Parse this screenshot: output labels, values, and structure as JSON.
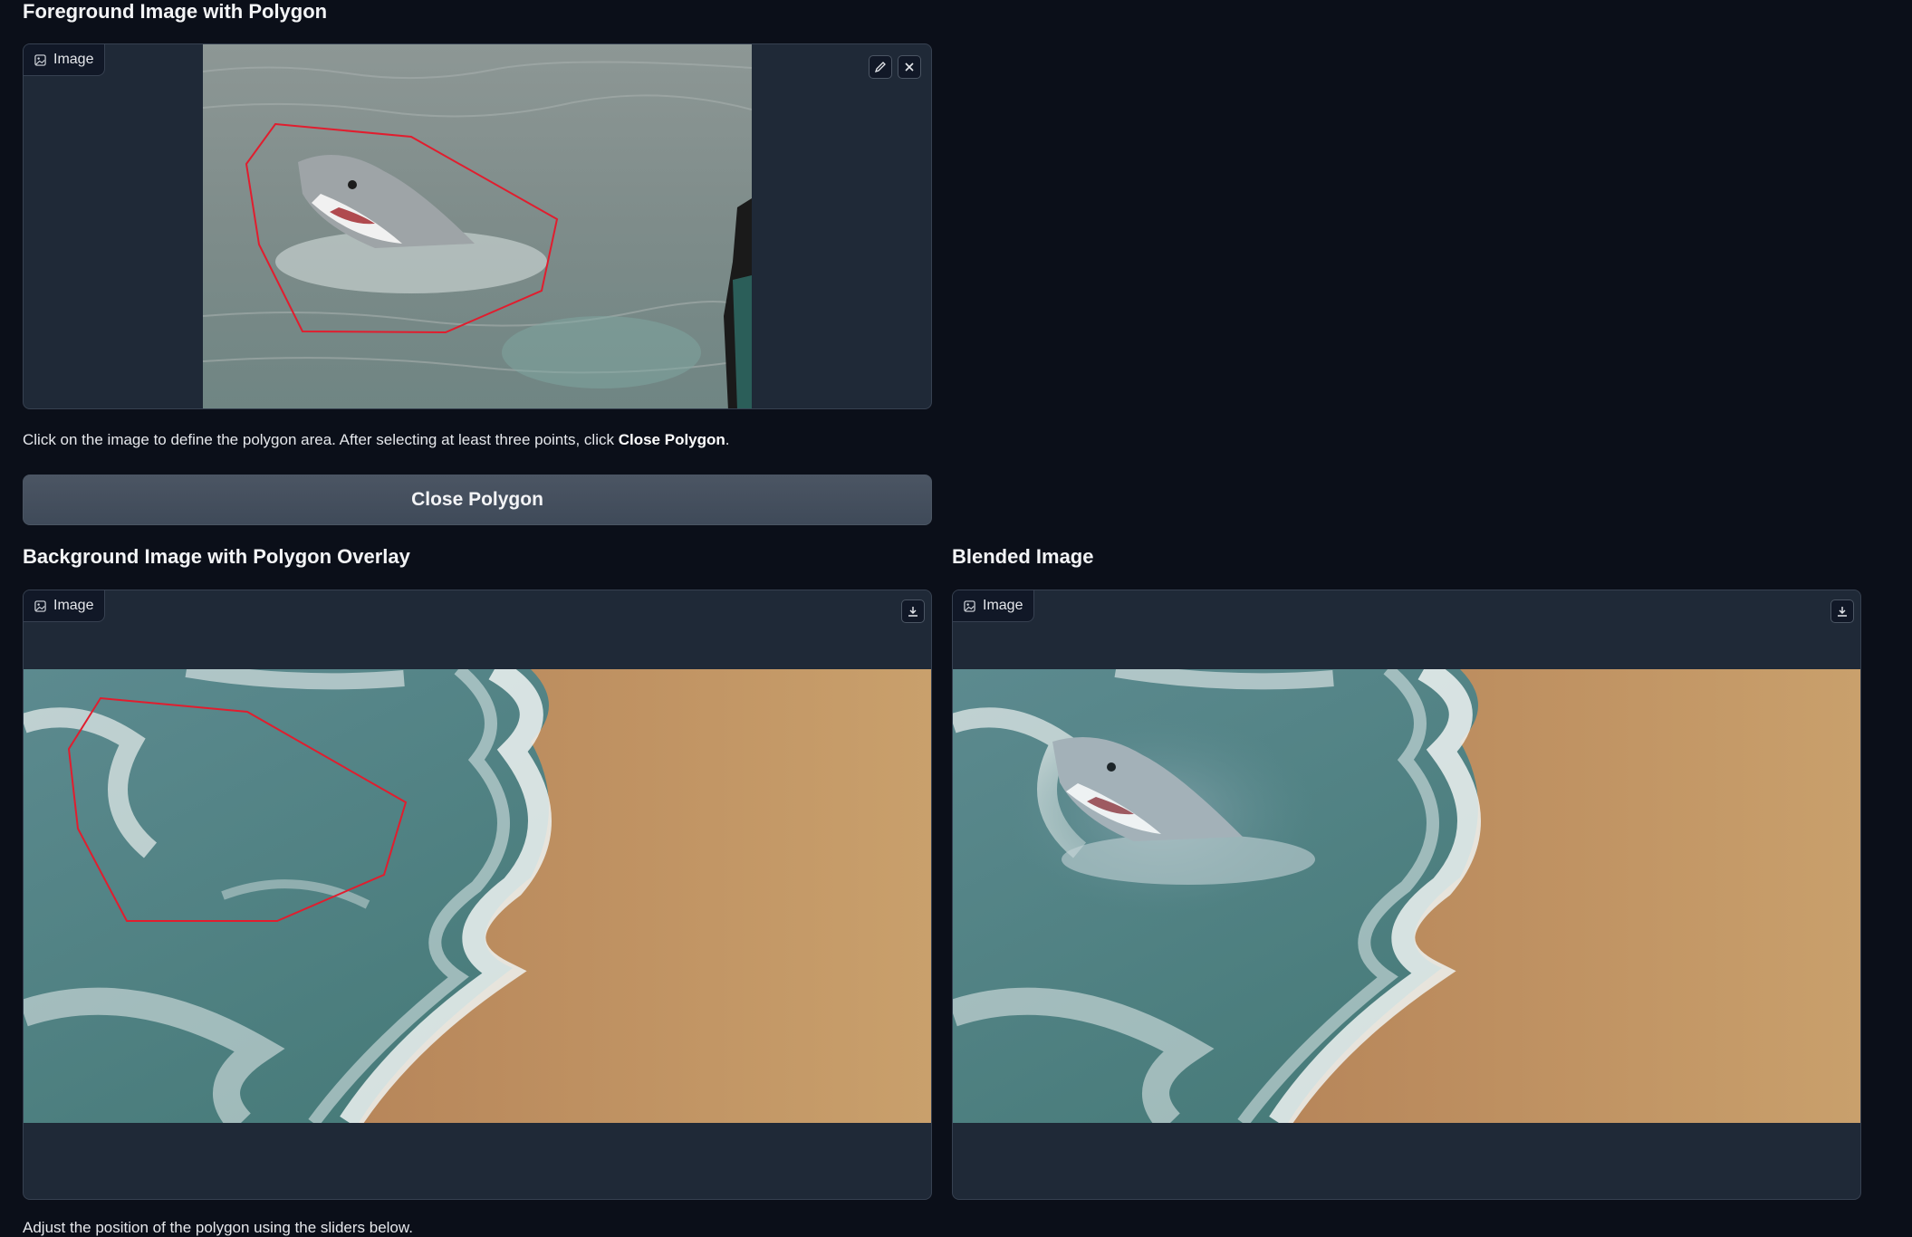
{
  "foreground": {
    "title": "Foreground Image with Polygon",
    "chip_label": "Image",
    "edit_icon": "pencil-icon",
    "close_icon": "close-icon"
  },
  "instructions": {
    "text_before": "Click on the image to define the polygon area. After selecting at least three points, click ",
    "bold": "Close Polygon",
    "text_after": "."
  },
  "close_button": {
    "label": "Close Polygon"
  },
  "background": {
    "title": "Background Image with Polygon Overlay",
    "chip_label": "Image",
    "download_icon": "download-icon"
  },
  "blended": {
    "title": "Blended Image",
    "chip_label": "Image",
    "download_icon": "download-icon"
  },
  "footer": {
    "note": "Adjust the position of the polygon using the sliders below."
  },
  "colors": {
    "polygon": "#e11d2e",
    "accent": "#1f2937"
  }
}
